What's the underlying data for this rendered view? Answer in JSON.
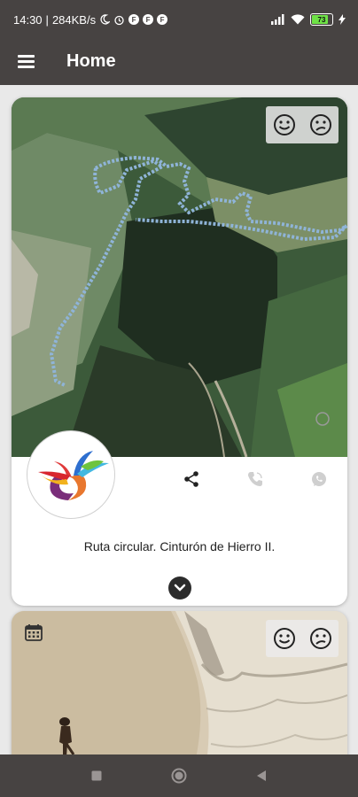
{
  "status_bar": {
    "time": "14:30",
    "network_speed": "284KB/s",
    "battery_level": "73",
    "icons": [
      "moon-icon",
      "alarm-icon",
      "app-f-icon",
      "app-f-icon",
      "app-f-icon",
      "signal-icon",
      "wifi-icon",
      "battery-icon",
      "charging-icon"
    ]
  },
  "app_bar": {
    "title": "Home",
    "menu_icon": "hamburger-menu-icon"
  },
  "cards": [
    {
      "route_title": "Ruta circular. Cinturón de Hierro II.",
      "image": "satellite-map-with-route",
      "rating_icons": [
        "smiley-happy-icon",
        "smiley-sad-icon"
      ],
      "actions": [
        "share-icon",
        "phone-icon",
        "whatsapp-icon"
      ],
      "expand_icon": "chevron-down-icon"
    },
    {
      "image": "beach-with-child",
      "rating_icons": [
        "smiley-happy-icon",
        "smiley-sad-icon"
      ],
      "calendar_icon": "calendar-icon"
    }
  ],
  "nav_bar": [
    "recents-square-icon",
    "home-circle-icon",
    "back-triangle-icon"
  ],
  "colors": {
    "bars": "#474342",
    "background": "#e9e9e9",
    "card": "#ffffff"
  }
}
